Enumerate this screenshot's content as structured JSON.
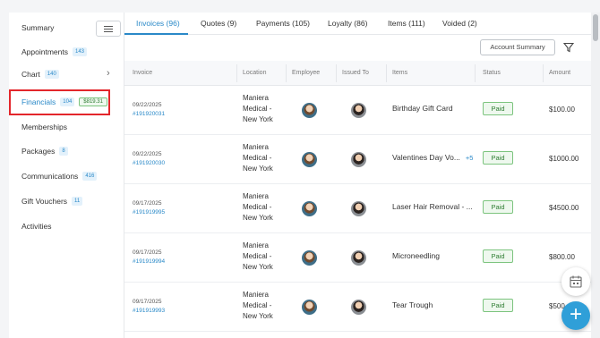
{
  "sidebar": {
    "items": [
      {
        "label": "Summary",
        "count": ""
      },
      {
        "label": "Appointments",
        "count": "143"
      },
      {
        "label": "Chart",
        "count": "140"
      },
      {
        "label": "Financials",
        "count": "104",
        "badge": "$819.31"
      },
      {
        "label": "Memberships",
        "count": ""
      },
      {
        "label": "Packages",
        "count": "8"
      },
      {
        "label": "Communications",
        "count": "416"
      },
      {
        "label": "Gift Vouchers",
        "count": "11"
      },
      {
        "label": "Activities",
        "count": ""
      }
    ]
  },
  "tabs": [
    {
      "label": "Invoices (96)"
    },
    {
      "label": "Quotes (9)"
    },
    {
      "label": "Payments (105)"
    },
    {
      "label": "Loyalty (86)"
    },
    {
      "label": "Items (111)"
    },
    {
      "label": "Voided (2)"
    }
  ],
  "toolbar": {
    "account_summary": "Account Summary"
  },
  "table": {
    "headers": [
      "Invoice",
      "Location",
      "Employee",
      "Issued To",
      "Items",
      "Status",
      "Amount"
    ],
    "rows": [
      {
        "date": "09/22/2025",
        "invoice": "#191920031",
        "location": "Maniera Medical - New York",
        "item": "Birthday Gift Card",
        "more": "",
        "status": "Paid",
        "amount": "$100.00"
      },
      {
        "date": "09/22/2025",
        "invoice": "#191920030",
        "location": "Maniera Medical - New York",
        "item": "Valentines Day Vo...",
        "more": "+5",
        "status": "Paid",
        "amount": "$1000.00"
      },
      {
        "date": "09/17/2025",
        "invoice": "#191919995",
        "location": "Maniera Medical - New York",
        "item": "Laser Hair Removal - ...",
        "more": "",
        "status": "Paid",
        "amount": "$4500.00"
      },
      {
        "date": "09/17/2025",
        "invoice": "#191919994",
        "location": "Maniera Medical - New York",
        "item": "Microneedling",
        "more": "",
        "status": "Paid",
        "amount": "$800.00"
      },
      {
        "date": "09/17/2025",
        "invoice": "#191919993",
        "location": "Maniera Medical - New York",
        "item": "Tear Trough",
        "more": "",
        "status": "Paid",
        "amount": "$500"
      }
    ]
  },
  "icons": {
    "menu": "hamburger-icon",
    "chevron": "chevron-right-icon",
    "filter": "filter-icon",
    "calendar": "calendar-icon",
    "add": "plus-icon"
  },
  "colors": {
    "accent": "#2a89c8",
    "paid": "#2e7d32",
    "highlight": "#e3262b",
    "fab": "#2f9fd8"
  }
}
